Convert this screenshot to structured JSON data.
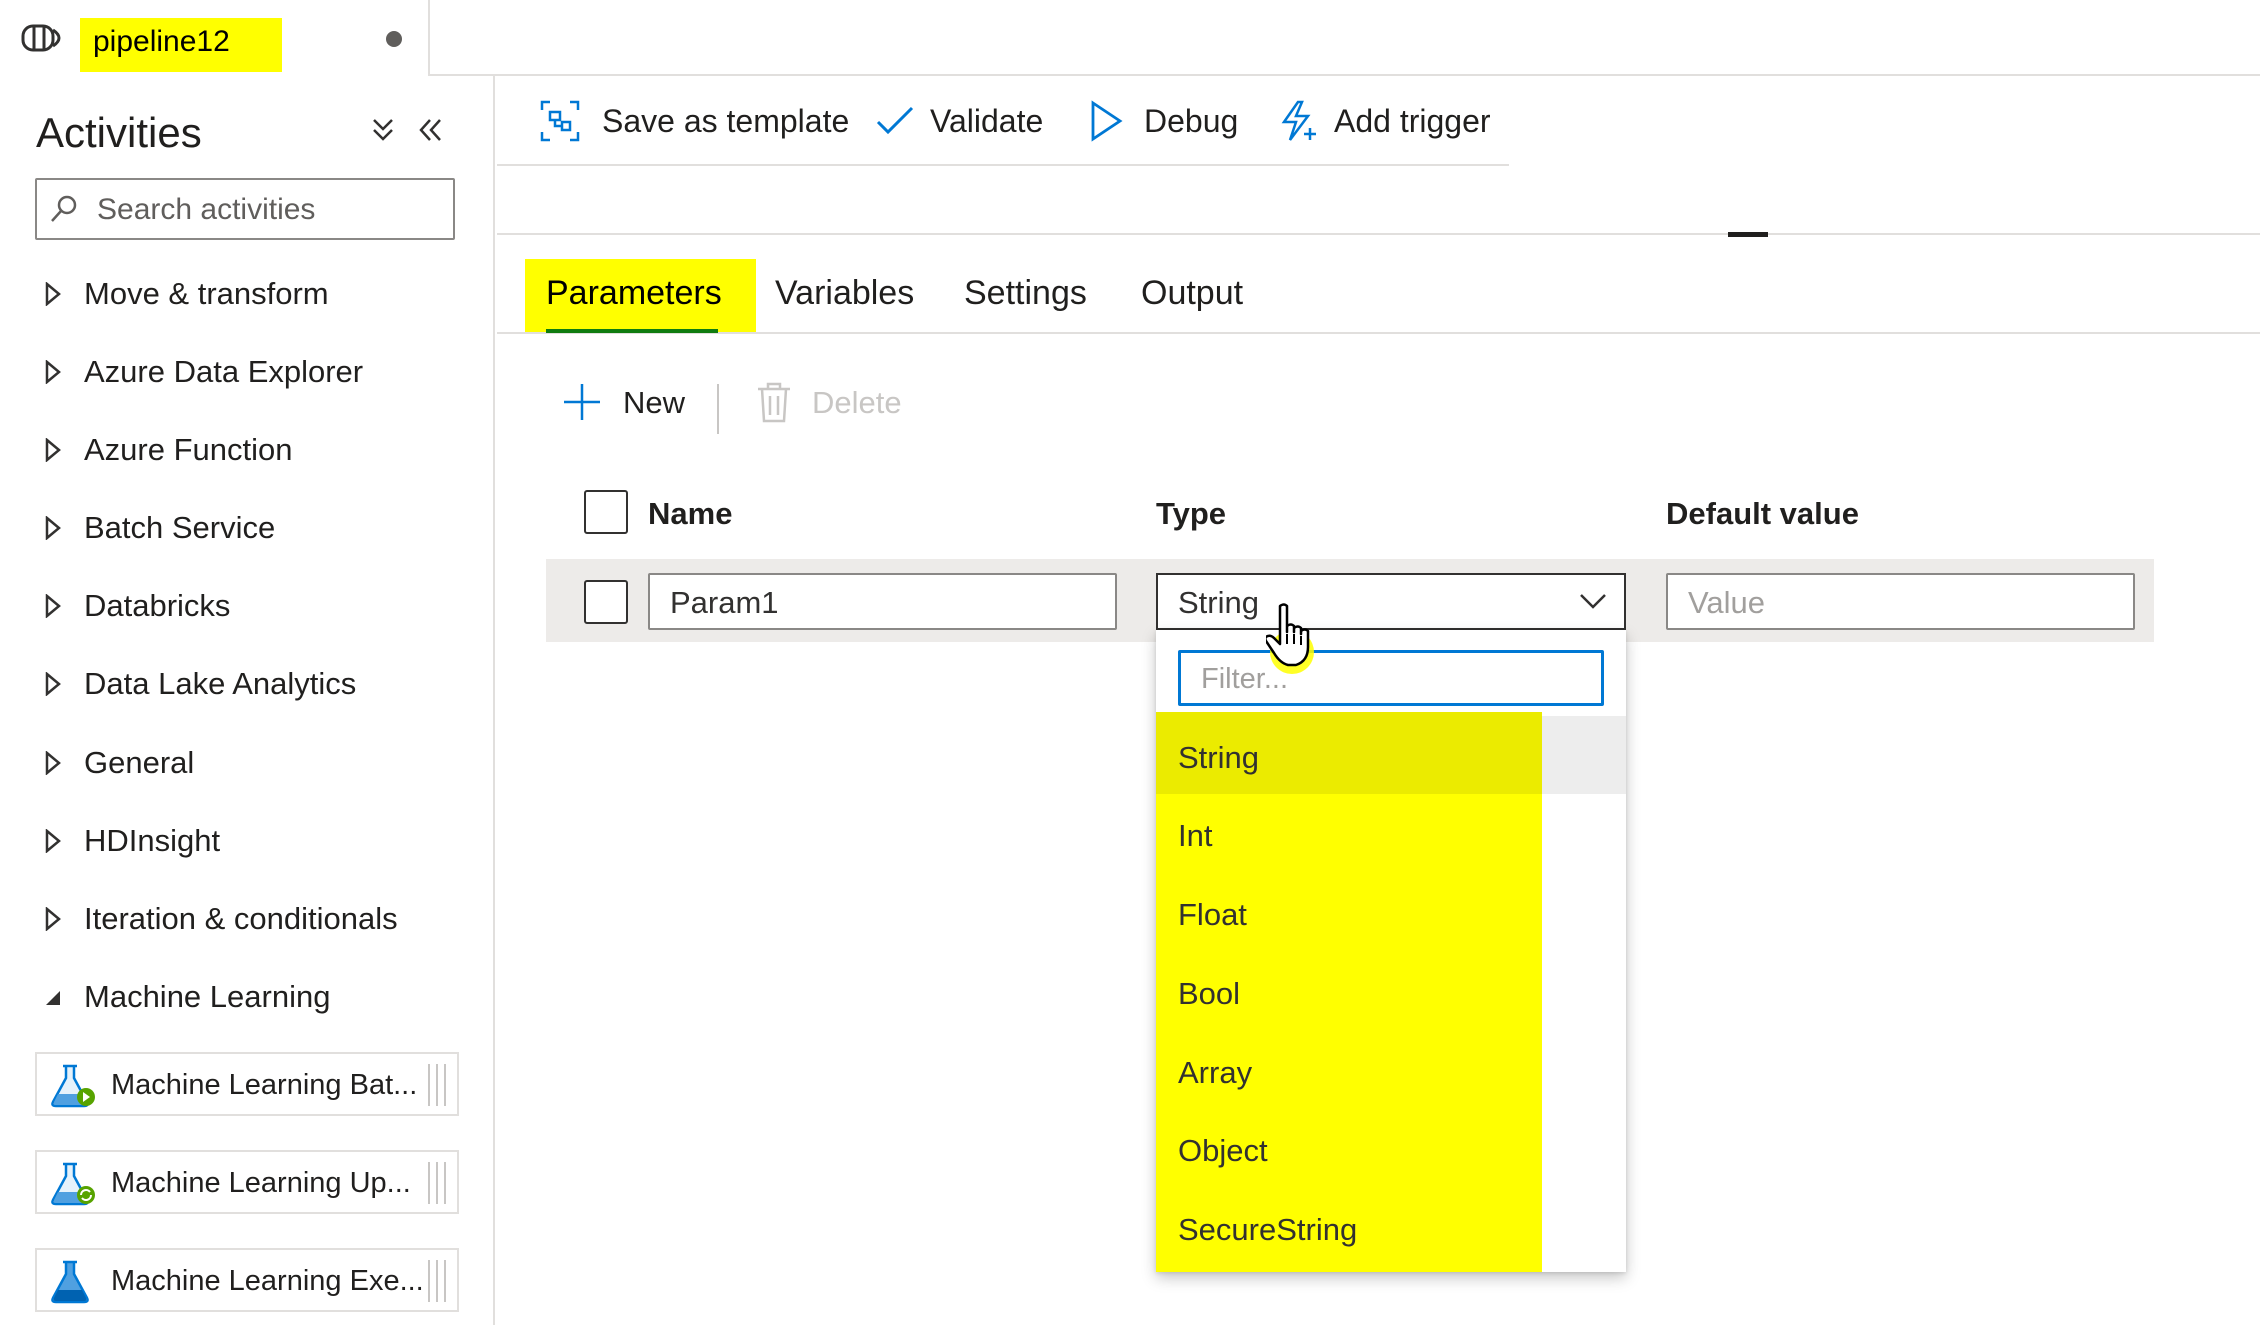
{
  "tab": {
    "title": "pipeline12",
    "unsaved": true
  },
  "sidebar": {
    "title": "Activities",
    "search_placeholder": "Search activities",
    "categories": [
      {
        "label": "Move & transform",
        "expanded": false
      },
      {
        "label": "Azure Data Explorer",
        "expanded": false
      },
      {
        "label": "Azure Function",
        "expanded": false
      },
      {
        "label": "Batch Service",
        "expanded": false
      },
      {
        "label": "Databricks",
        "expanded": false
      },
      {
        "label": "Data Lake Analytics",
        "expanded": false
      },
      {
        "label": "General",
        "expanded": false
      },
      {
        "label": "HDInsight",
        "expanded": false
      },
      {
        "label": "Iteration & conditionals",
        "expanded": false
      },
      {
        "label": "Machine Learning",
        "expanded": true
      }
    ],
    "activities": [
      {
        "label": "Machine Learning Bat...",
        "icon": "ml-batch-icon"
      },
      {
        "label": "Machine Learning Up...",
        "icon": "ml-update-icon"
      },
      {
        "label": "Machine Learning Exe...",
        "icon": "ml-execute-icon"
      }
    ]
  },
  "toolbar": {
    "save_template": "Save as template",
    "validate": "Validate",
    "debug": "Debug",
    "add_trigger": "Add trigger"
  },
  "property_tabs": {
    "parameters": "Parameters",
    "variables": "Variables",
    "settings": "Settings",
    "output": "Output",
    "active": "Parameters"
  },
  "commands": {
    "new": "New",
    "delete": "Delete"
  },
  "grid": {
    "headers": {
      "name": "Name",
      "type": "Type",
      "default_value": "Default value"
    },
    "rows": [
      {
        "name": "Param1",
        "type": "String",
        "default_placeholder": "Value"
      }
    ]
  },
  "dropdown": {
    "filter_placeholder": "Filter...",
    "options": [
      "String",
      "Int",
      "Float",
      "Bool",
      "Array",
      "Object",
      "SecureString"
    ],
    "selected": "String"
  },
  "colors": {
    "highlight": "#ffff00",
    "accent_blue": "#0078d4",
    "active_tab_underline": "#107c10"
  }
}
